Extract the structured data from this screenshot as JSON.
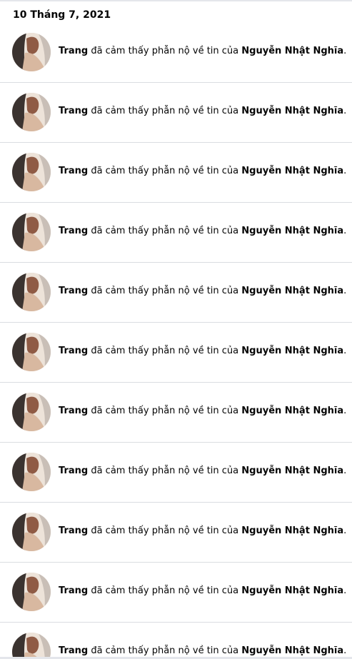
{
  "date_heading": "10 Tháng 7, 2021",
  "notifications": [
    {
      "actor": "Trang",
      "action": "đã cảm thấy phẫn nộ về tin của",
      "target": "Nguyễn Nhật Nghĩa",
      "end": "."
    },
    {
      "actor": "Trang",
      "action": "đã cảm thấy phẫn nộ về tin của",
      "target": "Nguyễn Nhật Nghĩa",
      "end": "."
    },
    {
      "actor": "Trang",
      "action": "đã cảm thấy phẫn nộ về tin của",
      "target": "Nguyễn Nhật Nghĩa",
      "end": "."
    },
    {
      "actor": "Trang",
      "action": "đã cảm thấy phẫn nộ về tin của",
      "target": "Nguyễn Nhật Nghĩa",
      "end": "."
    },
    {
      "actor": "Trang",
      "action": "đã cảm thấy phẫn nộ về tin của",
      "target": "Nguyễn Nhật Nghĩa",
      "end": "."
    },
    {
      "actor": "Trang",
      "action": "đã cảm thấy phẫn nộ về tin của",
      "target": "Nguyễn Nhật Nghĩa",
      "end": "."
    },
    {
      "actor": "Trang",
      "action": "đã cảm thấy phẫn nộ về tin của",
      "target": "Nguyễn Nhật Nghĩa",
      "end": "."
    },
    {
      "actor": "Trang",
      "action": "đã cảm thấy phẫn nộ về tin của",
      "target": "Nguyễn Nhật Nghĩa",
      "end": "."
    },
    {
      "actor": "Trang",
      "action": "đã cảm thấy phẫn nộ về tin của",
      "target": "Nguyễn Nhật Nghĩa",
      "end": "."
    },
    {
      "actor": "Trang",
      "action": "đã cảm thấy phẫn nộ về tin của",
      "target": "Nguyễn Nhật Nghĩa",
      "end": "."
    },
    {
      "actor": "Trang",
      "action": "đã cảm thấy phẫn nộ về tin của",
      "target": "Nguyễn Nhật Nghĩa",
      "end": "."
    }
  ]
}
